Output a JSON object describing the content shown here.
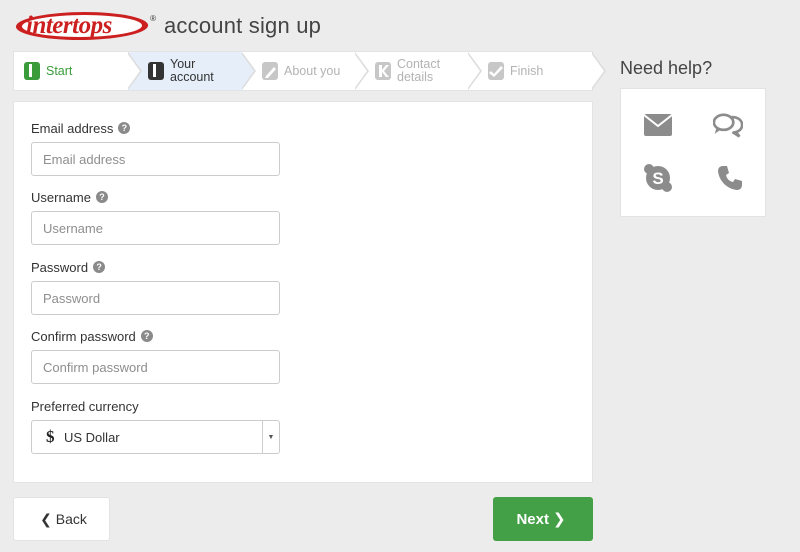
{
  "header": {
    "logo_text": "intertops",
    "logo_reg": "®",
    "title": "account sign up"
  },
  "steps": [
    {
      "label": "Start",
      "state": "done",
      "icon": "step-1-icon"
    },
    {
      "label": "Your account",
      "state": "active",
      "icon": "step-account-icon"
    },
    {
      "label": "About you",
      "state": "pending",
      "icon": "pencil-icon"
    },
    {
      "label": "Contact details",
      "state": "pending",
      "icon": "contact-icon"
    },
    {
      "label": "Finish",
      "state": "pending",
      "icon": "check-icon"
    }
  ],
  "form": {
    "email": {
      "label": "Email address",
      "placeholder": "Email address",
      "value": ""
    },
    "username": {
      "label": "Username",
      "placeholder": "Username",
      "value": ""
    },
    "password": {
      "label": "Password",
      "placeholder": "Password",
      "value": ""
    },
    "confirm": {
      "label": "Confirm password",
      "placeholder": "Confirm password",
      "value": ""
    },
    "currency": {
      "label": "Preferred currency",
      "symbol": "$",
      "value": "US Dollar"
    },
    "help_glyph": "?"
  },
  "help_panel": {
    "title": "Need help?",
    "icons": [
      "email-icon",
      "chat-icon",
      "skype-icon",
      "phone-icon"
    ]
  },
  "buttons": {
    "back": "Back",
    "next": "Next"
  },
  "colors": {
    "brand_red": "#cc1f1f",
    "accent_green": "#43a047",
    "active_step_bg": "#e6eefa"
  }
}
